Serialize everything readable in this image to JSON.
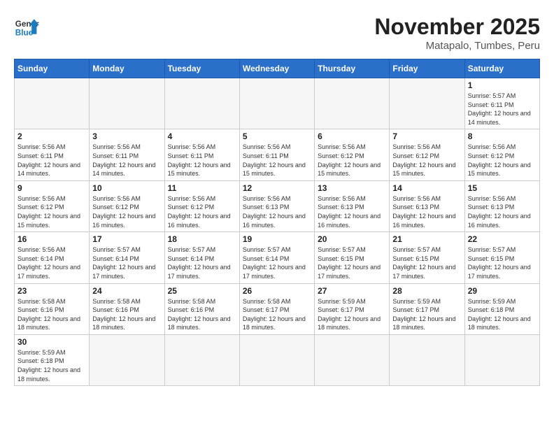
{
  "header": {
    "logo_general": "General",
    "logo_blue": "Blue",
    "month": "November 2025",
    "location": "Matapalo, Tumbes, Peru"
  },
  "weekdays": [
    "Sunday",
    "Monday",
    "Tuesday",
    "Wednesday",
    "Thursday",
    "Friday",
    "Saturday"
  ],
  "days": [
    {
      "date": "",
      "info": ""
    },
    {
      "date": "",
      "info": ""
    },
    {
      "date": "",
      "info": ""
    },
    {
      "date": "",
      "info": ""
    },
    {
      "date": "",
      "info": ""
    },
    {
      "date": "",
      "info": ""
    },
    {
      "date": "1",
      "info": "Sunrise: 5:57 AM\nSunset: 6:11 PM\nDaylight: 12 hours and 14 minutes."
    },
    {
      "date": "2",
      "info": "Sunrise: 5:56 AM\nSunset: 6:11 PM\nDaylight: 12 hours and 14 minutes."
    },
    {
      "date": "3",
      "info": "Sunrise: 5:56 AM\nSunset: 6:11 PM\nDaylight: 12 hours and 14 minutes."
    },
    {
      "date": "4",
      "info": "Sunrise: 5:56 AM\nSunset: 6:11 PM\nDaylight: 12 hours and 15 minutes."
    },
    {
      "date": "5",
      "info": "Sunrise: 5:56 AM\nSunset: 6:11 PM\nDaylight: 12 hours and 15 minutes."
    },
    {
      "date": "6",
      "info": "Sunrise: 5:56 AM\nSunset: 6:12 PM\nDaylight: 12 hours and 15 minutes."
    },
    {
      "date": "7",
      "info": "Sunrise: 5:56 AM\nSunset: 6:12 PM\nDaylight: 12 hours and 15 minutes."
    },
    {
      "date": "8",
      "info": "Sunrise: 5:56 AM\nSunset: 6:12 PM\nDaylight: 12 hours and 15 minutes."
    },
    {
      "date": "9",
      "info": "Sunrise: 5:56 AM\nSunset: 6:12 PM\nDaylight: 12 hours and 15 minutes."
    },
    {
      "date": "10",
      "info": "Sunrise: 5:56 AM\nSunset: 6:12 PM\nDaylight: 12 hours and 16 minutes."
    },
    {
      "date": "11",
      "info": "Sunrise: 5:56 AM\nSunset: 6:12 PM\nDaylight: 12 hours and 16 minutes."
    },
    {
      "date": "12",
      "info": "Sunrise: 5:56 AM\nSunset: 6:13 PM\nDaylight: 12 hours and 16 minutes."
    },
    {
      "date": "13",
      "info": "Sunrise: 5:56 AM\nSunset: 6:13 PM\nDaylight: 12 hours and 16 minutes."
    },
    {
      "date": "14",
      "info": "Sunrise: 5:56 AM\nSunset: 6:13 PM\nDaylight: 12 hours and 16 minutes."
    },
    {
      "date": "15",
      "info": "Sunrise: 5:56 AM\nSunset: 6:13 PM\nDaylight: 12 hours and 16 minutes."
    },
    {
      "date": "16",
      "info": "Sunrise: 5:56 AM\nSunset: 6:14 PM\nDaylight: 12 hours and 17 minutes."
    },
    {
      "date": "17",
      "info": "Sunrise: 5:57 AM\nSunset: 6:14 PM\nDaylight: 12 hours and 17 minutes."
    },
    {
      "date": "18",
      "info": "Sunrise: 5:57 AM\nSunset: 6:14 PM\nDaylight: 12 hours and 17 minutes."
    },
    {
      "date": "19",
      "info": "Sunrise: 5:57 AM\nSunset: 6:14 PM\nDaylight: 12 hours and 17 minutes."
    },
    {
      "date": "20",
      "info": "Sunrise: 5:57 AM\nSunset: 6:15 PM\nDaylight: 12 hours and 17 minutes."
    },
    {
      "date": "21",
      "info": "Sunrise: 5:57 AM\nSunset: 6:15 PM\nDaylight: 12 hours and 17 minutes."
    },
    {
      "date": "22",
      "info": "Sunrise: 5:57 AM\nSunset: 6:15 PM\nDaylight: 12 hours and 17 minutes."
    },
    {
      "date": "23",
      "info": "Sunrise: 5:58 AM\nSunset: 6:16 PM\nDaylight: 12 hours and 18 minutes."
    },
    {
      "date": "24",
      "info": "Sunrise: 5:58 AM\nSunset: 6:16 PM\nDaylight: 12 hours and 18 minutes."
    },
    {
      "date": "25",
      "info": "Sunrise: 5:58 AM\nSunset: 6:16 PM\nDaylight: 12 hours and 18 minutes."
    },
    {
      "date": "26",
      "info": "Sunrise: 5:58 AM\nSunset: 6:17 PM\nDaylight: 12 hours and 18 minutes."
    },
    {
      "date": "27",
      "info": "Sunrise: 5:59 AM\nSunset: 6:17 PM\nDaylight: 12 hours and 18 minutes."
    },
    {
      "date": "28",
      "info": "Sunrise: 5:59 AM\nSunset: 6:17 PM\nDaylight: 12 hours and 18 minutes."
    },
    {
      "date": "29",
      "info": "Sunrise: 5:59 AM\nSunset: 6:18 PM\nDaylight: 12 hours and 18 minutes."
    },
    {
      "date": "30",
      "info": "Sunrise: 5:59 AM\nSunset: 6:18 PM\nDaylight: 12 hours and 18 minutes."
    },
    {
      "date": "",
      "info": ""
    },
    {
      "date": "",
      "info": ""
    },
    {
      "date": "",
      "info": ""
    },
    {
      "date": "",
      "info": ""
    },
    {
      "date": "",
      "info": ""
    },
    {
      "date": "",
      "info": ""
    }
  ]
}
